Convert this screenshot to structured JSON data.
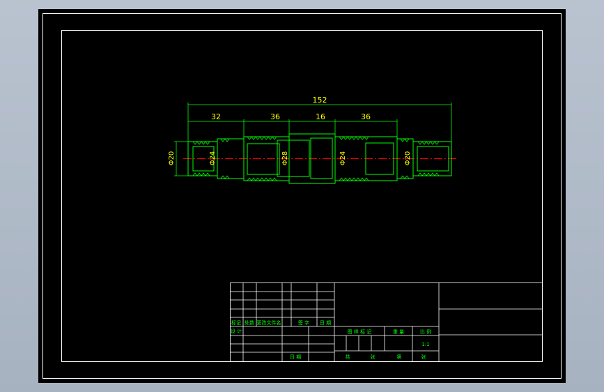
{
  "drawing": {
    "overall_length": "152",
    "segment_lengths": [
      "32",
      "36",
      "16",
      "36"
    ],
    "diameter_labels": [
      "Φ20",
      "Φ24",
      "Φ28",
      "Φ24",
      "Φ20"
    ]
  },
  "title_block": {
    "revision_headers": [
      "标记",
      "处数",
      "更改文件名",
      "签 字",
      "日 期"
    ],
    "design_labels": [
      "设 计",
      "日 期"
    ],
    "info_headers": [
      "图 样 标 记",
      "重 量",
      "比 例"
    ],
    "scale_value": "1:1",
    "sheet_labels": [
      "共",
      "张",
      "第",
      "张"
    ]
  },
  "colors": {
    "background": "#000000",
    "frame": "#ffffff",
    "outline": "#00ff00",
    "dimension_text": "#ffff00",
    "centerline": "#ff0000"
  }
}
